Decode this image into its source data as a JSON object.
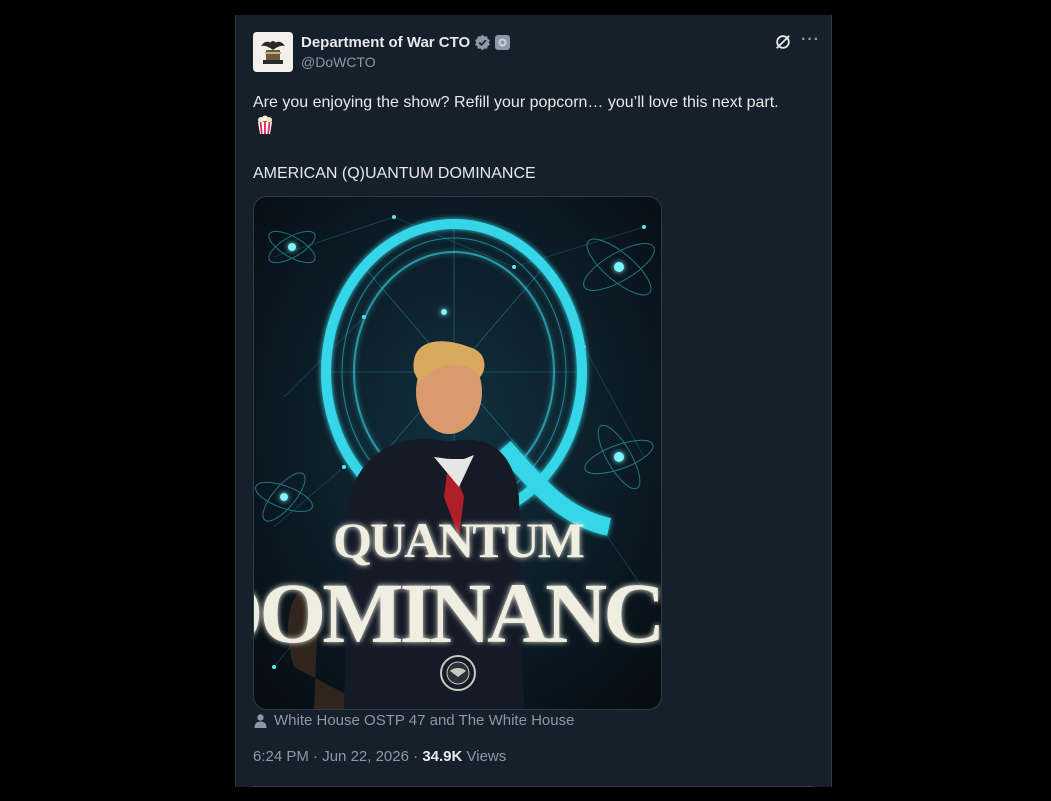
{
  "tweet": {
    "author": {
      "display_name": "Department of War CTO",
      "handle": "@DoWCTO"
    },
    "text_line1": "Are you enjoying the show? Refill your popcorn… you’ll love this next part.",
    "text_line2": "AMERICAN (Q)UANTUM DOMINANCE",
    "media": {
      "line1": "QUANTUM",
      "line2": "DOMINANCE",
      "letter": "Q"
    },
    "tagged": "White House OSTP 47 and The White House",
    "time": "6:24 PM",
    "date": "Jun 22, 2026",
    "views_count": "34.9K",
    "views_label": "Views"
  },
  "colors": {
    "background": "#15202b",
    "accent": "#1d9bf0",
    "text_primary": "#e7e9ea",
    "text_secondary": "#8b98a5",
    "glow": "#35d6e8"
  },
  "icons": [
    "verified-badge-icon",
    "affiliation-badge-icon",
    "grok-icon",
    "more-icon",
    "popcorn-emoji-icon",
    "person-icon"
  ]
}
